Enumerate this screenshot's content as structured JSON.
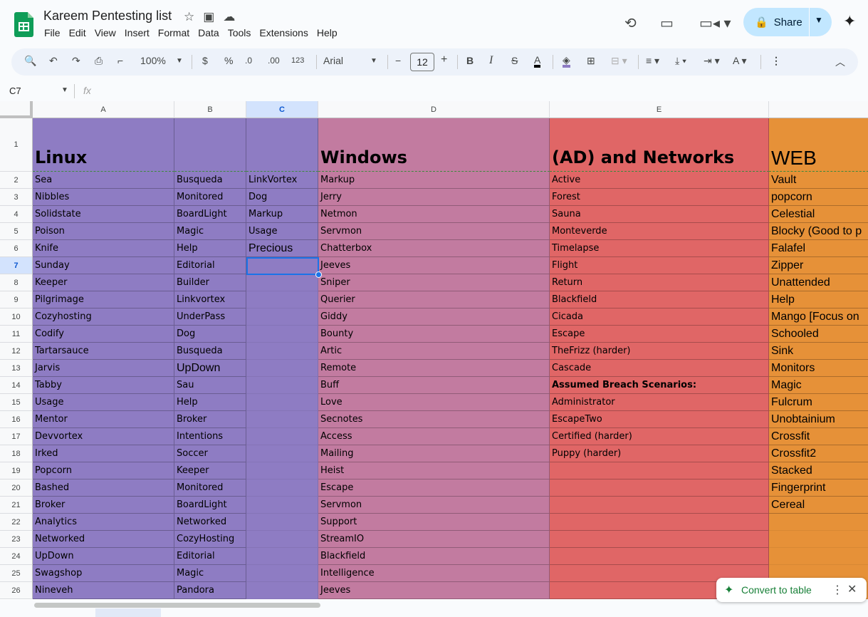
{
  "doc": {
    "title": "Kareem Pentesting list"
  },
  "menu": [
    "File",
    "Edit",
    "View",
    "Insert",
    "Format",
    "Data",
    "Tools",
    "Extensions",
    "Help"
  ],
  "share": {
    "label": "Share"
  },
  "toolbar": {
    "zoom": "100%",
    "currency": "$",
    "percent": "%",
    "dec_decrease": ".0",
    "dec_increase": ".00",
    "number_format": "123",
    "font": "Arial",
    "font_size": "12"
  },
  "formula": {
    "name_box": "C7",
    "fx": "fx"
  },
  "columns": [
    "A",
    "B",
    "C",
    "D",
    "E"
  ],
  "rows": [
    "1",
    "2",
    "3",
    "4",
    "5",
    "6",
    "7",
    "8",
    "9",
    "10",
    "11",
    "12",
    "13",
    "14",
    "15",
    "16",
    "17",
    "18",
    "19",
    "20",
    "21",
    "22",
    "23",
    "24",
    "25",
    "26"
  ],
  "headers": {
    "linux": "Linux",
    "windows": "Windows",
    "ad": "(AD) and Networks",
    "web": "WEB"
  },
  "col_a": [
    "Sea",
    "Nibbles",
    "Solidstate",
    "Poison",
    "Knife",
    "Sunday",
    "Keeper",
    "Pilgrimage",
    "Cozyhosting",
    "Codify",
    "Tartarsauce",
    "Jarvis",
    "Tabby",
    "Usage",
    "Mentor",
    "Devvortex",
    "Irked",
    "Popcorn",
    "Bashed",
    "Broker",
    "Analytics",
    "Networked",
    "UpDown",
    "Swagshop",
    "Nineveh"
  ],
  "col_b": [
    "Busqueda",
    "Monitored",
    "BoardLight",
    "Magic",
    "Help",
    "Editorial",
    "Builder",
    "Linkvortex",
    "UnderPass",
    "Dog",
    "Busqueda",
    "UpDown",
    "Sau",
    "Help",
    "Broker",
    "Intentions",
    "Soccer",
    "Keeper",
    "Monitored",
    "BoardLight",
    "Networked",
    "CozyHosting",
    "Editorial",
    "Magic",
    "Pandora"
  ],
  "col_c": [
    "LinkVortex",
    "Dog",
    "Markup",
    "Usage",
    "Precious"
  ],
  "col_d": [
    "Markup",
    "Jerry",
    "Netmon",
    "Servmon",
    "Chatterbox",
    "Jeeves",
    "Sniper",
    "Querier",
    "Giddy",
    "Bounty",
    "Artic",
    "Remote",
    "Buff",
    "Love",
    "Secnotes",
    "Access",
    "Mailing",
    "Heist",
    "Escape",
    "Servmon",
    "Support",
    "StreamIO",
    "Blackfield",
    "Intelligence",
    "Jeeves"
  ],
  "col_e": [
    "Active",
    "Forest",
    "Sauna",
    "Monteverde",
    "Timelapse",
    "Flight",
    "Return",
    "Blackfield",
    "Cicada",
    "Escape",
    "TheFrizz (harder)",
    "Cascade",
    "Assumed Breach Scenarios:",
    "Administrator",
    "EscapeTwo",
    "Certified (harder)",
    "Puppy (harder)"
  ],
  "col_f": [
    "Vault",
    "popcorn",
    "Celestial",
    "Blocky (Good to p",
    "Falafel",
    "Zipper",
    "Unattended",
    "Help",
    "Mango [Focus on",
    "Schooled",
    "Sink",
    "Monitors",
    "Magic",
    "Fulcrum",
    "Unobtainium",
    "Crossfit",
    "Crossfit2",
    "Stacked",
    "Fingerprint",
    "Cereal"
  ],
  "convert": {
    "label": "Convert to table"
  },
  "colors": {
    "linux": "#8e7cc3",
    "windows": "#c27ba0",
    "ad": "#e06666",
    "web": "#e69138",
    "share": "#c2e7ff"
  }
}
